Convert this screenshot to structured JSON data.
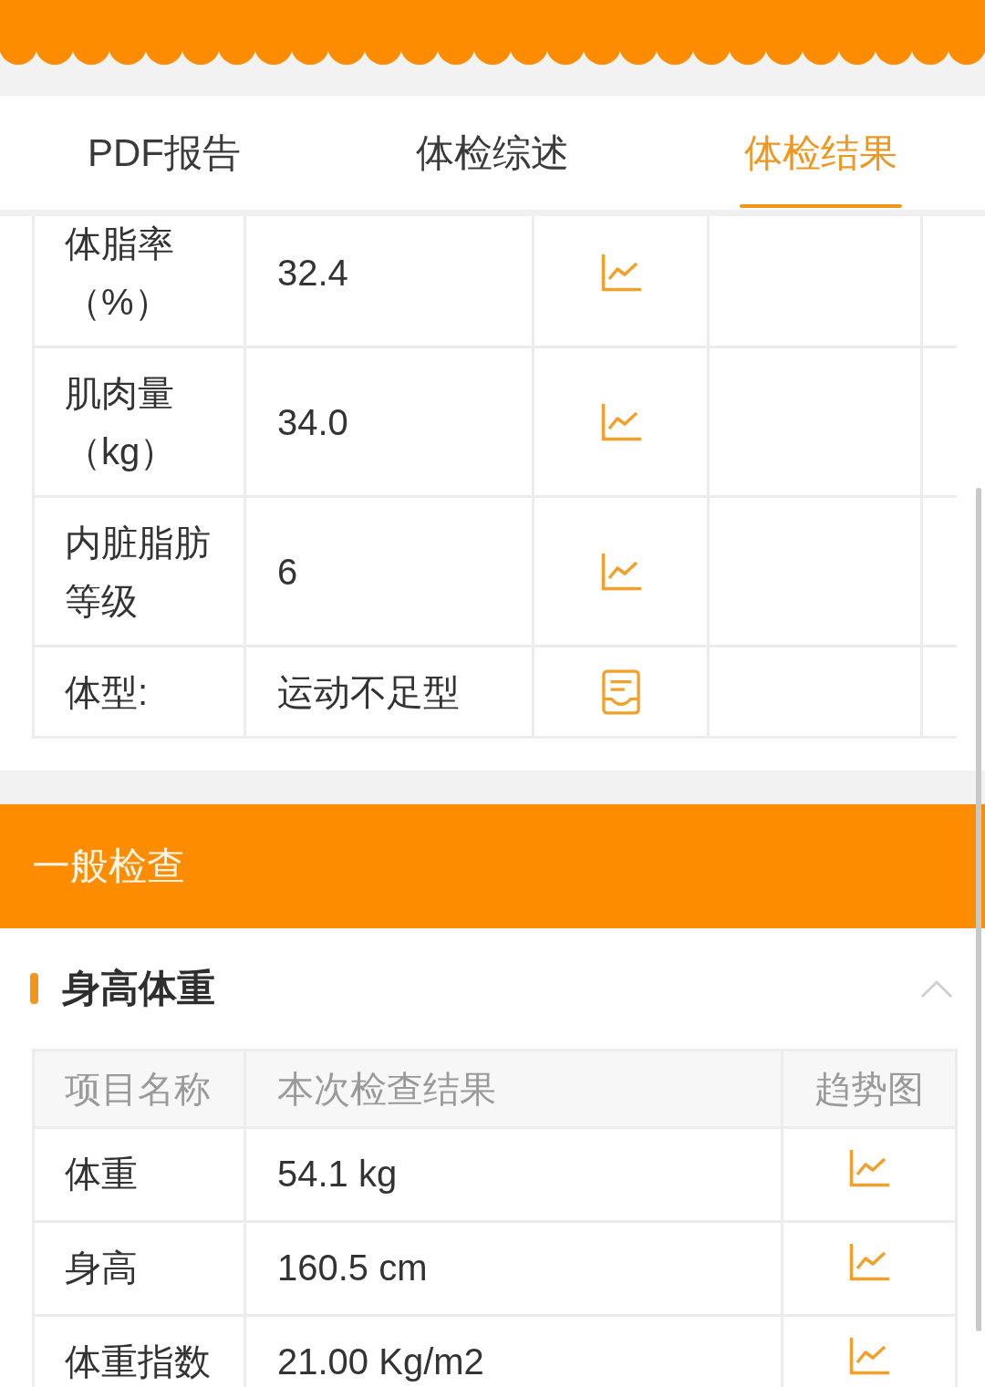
{
  "tabs": [
    {
      "label": "PDF报告",
      "selected": false
    },
    {
      "label": "体检综述",
      "selected": false
    },
    {
      "label": "体检结果",
      "selected": true
    }
  ],
  "body_composition_table": {
    "rows": [
      {
        "name": "体脂率（%）",
        "value": "32.4",
        "kind": "trend"
      },
      {
        "name": "肌肉量（kg）",
        "value": "34.0",
        "kind": "trend"
      },
      {
        "name": "内脏脂肪等级",
        "value": "6",
        "kind": "trend"
      },
      {
        "name": "体型:",
        "value": "运动不足型",
        "kind": "document"
      }
    ]
  },
  "section": {
    "title": "一般检查"
  },
  "subsection": {
    "title": "身高体重",
    "expanded": true
  },
  "table": {
    "columns": [
      "项目名称",
      "本次检查结果",
      "趋势图"
    ],
    "rows": [
      {
        "name": "体重",
        "result": "54.1 kg"
      },
      {
        "name": "身高",
        "result": "160.5 cm"
      },
      {
        "name": "体重指数",
        "result": "21.00 Kg/m2"
      }
    ]
  }
}
